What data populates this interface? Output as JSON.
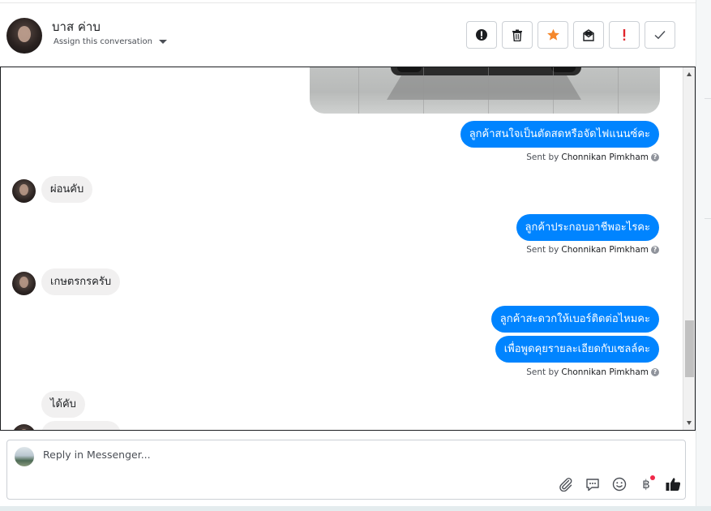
{
  "header": {
    "contact_name": "บาส ค่าบ",
    "assign_label": "Assign this conversation",
    "actions": [
      {
        "icon": "alert-circle-icon",
        "label": "Mark as important"
      },
      {
        "icon": "trash-icon",
        "label": "Delete"
      },
      {
        "icon": "star-icon",
        "label": "Follow up",
        "color": "#f5872b"
      },
      {
        "icon": "mark-unread-icon",
        "label": "Mark as unread"
      },
      {
        "icon": "exclamation-icon",
        "label": "Mark as spam",
        "color": "#e0242b"
      },
      {
        "icon": "check-icon",
        "label": "Mark as done"
      }
    ]
  },
  "messages": [
    {
      "direction": "out",
      "text": "ลูกค้าสนใจเป็นตัดสดหรือจัดไฟแนนซ์คะ",
      "sent_prefix": "Sent by",
      "sender": "Chonnikan Pimkham"
    },
    {
      "direction": "in",
      "text": "ผ่อนคับ"
    },
    {
      "direction": "out",
      "text": "ลูกค้าประกอบอาชีพอะไรคะ",
      "sent_prefix": "Sent by",
      "sender": "Chonnikan Pimkham"
    },
    {
      "direction": "in",
      "text": "เกษตรกรครับ"
    },
    {
      "direction": "out",
      "text": "ลูกค้าสะดวกให้เบอร์ติดต่อไหมคะ"
    },
    {
      "direction": "out",
      "text": "เพื่อพูดคุยรายละเอียดกับเซลล์คะ",
      "sent_prefix": "Sent by",
      "sender": "Chonnikan Pimkham"
    },
    {
      "direction": "in",
      "text": "ได้คับ"
    }
  ],
  "reply": {
    "placeholder": "Reply in Messenger...",
    "tools": [
      "paperclip-icon",
      "saved-reply-icon",
      "emoji-icon",
      "baht-payment-icon",
      "thumbs-up-icon"
    ],
    "baht_symbol": "฿",
    "brand_color": "#0084ff"
  }
}
